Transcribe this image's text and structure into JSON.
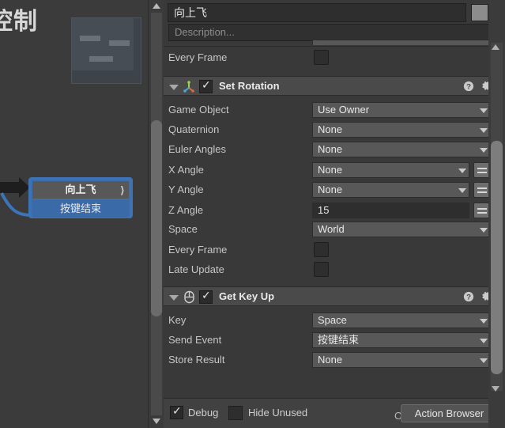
{
  "graph": {
    "title_partial": "控制",
    "selected_state": {
      "name": "向上飞",
      "sound_glyph": "⟩",
      "event": "按键结束"
    },
    "faded_state": {
      "name": ""
    }
  },
  "inspector": {
    "state_name": "向上飞",
    "description_placeholder": "Description...",
    "every_frame_label": "Every Frame",
    "actions": [
      {
        "title": "Set Rotation",
        "icon": "axis-gizmo-icon",
        "enabled": true,
        "fields": [
          {
            "label": "Game Object",
            "value": "Use Owner",
            "type": "dropdown"
          },
          {
            "label": "Quaternion",
            "value": "None",
            "type": "dropdown"
          },
          {
            "label": "Euler Angles",
            "value": "None",
            "type": "dropdown"
          },
          {
            "label": "X Angle",
            "value": "None",
            "type": "dropdown-var"
          },
          {
            "label": "Y Angle",
            "value": "None",
            "type": "dropdown-var"
          },
          {
            "label": "Z Angle",
            "value": "15",
            "type": "text-var"
          },
          {
            "label": "Space",
            "value": "World",
            "type": "dropdown"
          },
          {
            "label": "Every Frame",
            "value": "",
            "type": "checkbox"
          },
          {
            "label": "Late Update",
            "value": "",
            "type": "checkbox"
          }
        ]
      },
      {
        "title": "Get Key Up",
        "icon": "mouse-icon",
        "enabled": true,
        "fields": [
          {
            "label": "Key",
            "value": "Space",
            "type": "dropdown"
          },
          {
            "label": "Send Event",
            "value": "按键结束",
            "type": "dropdown"
          },
          {
            "label": "Store Result",
            "value": "None",
            "type": "dropdown"
          }
        ]
      }
    ]
  },
  "bottom_bar": {
    "debug_label": "Debug",
    "debug_checked": true,
    "hide_unused_label": "Hide Unused",
    "hide_unused_checked": false,
    "action_browser_label": "Action Browser",
    "watermark": "CSDN @达Bo"
  },
  "colors": {
    "panel_bg": "#393939",
    "field_bg": "#585858",
    "text_input_bg": "#2e2e2e",
    "action_header_bg": "#4a4a4a",
    "selection_blue": "#3d74b8",
    "state_event_blue": "#3a6ba8"
  }
}
